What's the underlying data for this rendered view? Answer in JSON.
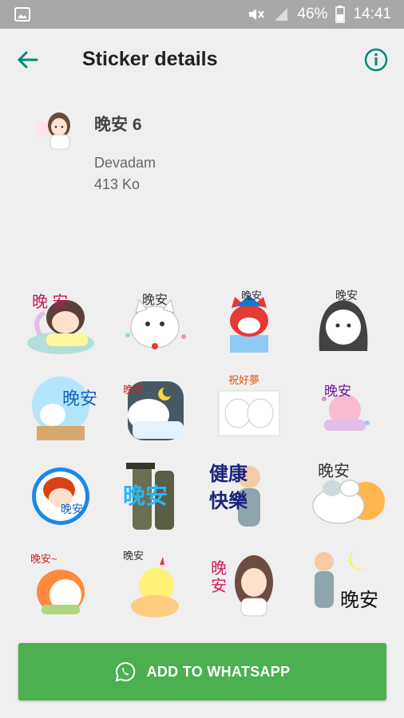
{
  "status_bar": {
    "battery": "46%",
    "time": "14:41"
  },
  "app_bar": {
    "title": "Sticker details"
  },
  "pack": {
    "name": "晚安 6",
    "author": "Devadam",
    "size": "413 Ko"
  },
  "stickers": [
    {
      "caption": "晚 安"
    },
    {
      "caption": "晚安"
    },
    {
      "caption": "晚安"
    },
    {
      "caption": "晚安"
    },
    {
      "caption": "晚安"
    },
    {
      "caption": "晚安"
    },
    {
      "caption": "祝好夢"
    },
    {
      "caption": "晚安"
    },
    {
      "caption": "晚安"
    },
    {
      "caption": "晚安"
    },
    {
      "caption": "健康 快樂"
    },
    {
      "caption": "晚安"
    },
    {
      "caption": "晚安~"
    },
    {
      "caption": "晚安"
    },
    {
      "caption": "晚安"
    },
    {
      "caption": "晚安"
    }
  ],
  "add_button": {
    "label": "ADD TO WHATSAPP"
  },
  "colors": {
    "accent": "#00897b",
    "button": "#4caf50",
    "status_bar": "#a8a8a8"
  }
}
